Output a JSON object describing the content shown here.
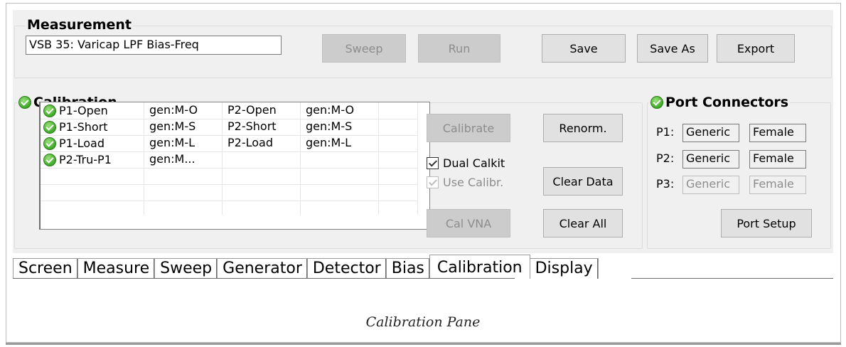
{
  "measurement": {
    "title": "Measurement",
    "name_value": "VSB 35: Varicap LPF Bias-Freq",
    "buttons": {
      "sweep": "Sweep",
      "run": "Run",
      "save": "Save",
      "save_as": "Save As",
      "export": "Export"
    }
  },
  "calibration": {
    "title": "Calibration",
    "rows": [
      {
        "std": "P1-Open",
        "p1_kit": "gen:M-O",
        "p2_std": "P2-Open",
        "p2_kit": "gen:M-O"
      },
      {
        "std": "P1-Short",
        "p1_kit": "gen:M-S",
        "p2_std": "P2-Short",
        "p2_kit": "gen:M-S"
      },
      {
        "std": "P1-Load",
        "p1_kit": "gen:M-L",
        "p2_std": "P2-Load",
        "p2_kit": "gen:M-L"
      },
      {
        "std": "P2-Tru-P1",
        "p1_kit": "gen:M...",
        "p2_std": "",
        "p2_kit": ""
      }
    ],
    "buttons": {
      "calibrate": "Calibrate",
      "renorm": "Renorm.",
      "clear_data": "Clear Data",
      "cal_vna": "Cal VNA",
      "clear_all": "Clear All"
    },
    "dual_calkit": {
      "label": "Dual Calkit",
      "checked": true
    },
    "use_calibr": {
      "label": "Use Calibr.",
      "checked": true
    }
  },
  "ports": {
    "title": "Port Connectors",
    "p1": {
      "label": "P1:",
      "type": "Generic",
      "gender": "Female"
    },
    "p2": {
      "label": "P2:",
      "type": "Generic",
      "gender": "Female"
    },
    "p3": {
      "label": "P3:",
      "type": "Generic",
      "gender": "Female"
    },
    "setup": "Port Setup"
  },
  "tabs": [
    "Screen",
    "Measure",
    "Sweep",
    "Generator",
    "Detector",
    "Bias",
    "Calibration",
    "Display"
  ],
  "active_tab": "Calibration",
  "caption": "Calibration Pane",
  "colors": {
    "status_ok": "#3fa92a",
    "disabled_text": "#8d8d8d"
  }
}
